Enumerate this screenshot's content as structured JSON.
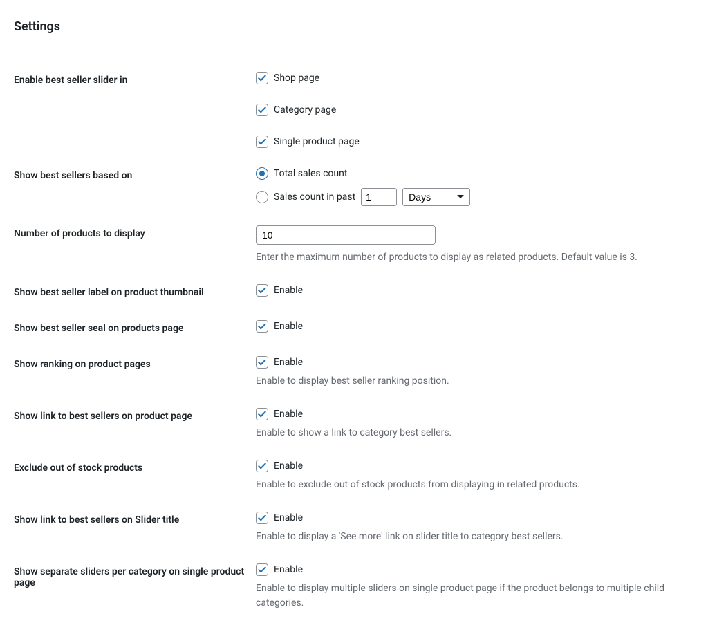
{
  "page": {
    "title": "Settings"
  },
  "rows": {
    "enable_slider": {
      "label": "Enable best seller slider in",
      "options": [
        "Shop page",
        "Category page",
        "Single product page"
      ]
    },
    "based_on": {
      "label": "Show best sellers based on",
      "radio_total": "Total sales count",
      "radio_past": "Sales count in past",
      "past_value": "1",
      "unit_selected": "Days"
    },
    "num_products": {
      "label": "Number of products to display",
      "value": "10",
      "desc": "Enter the maximum number of products to display as related products. Default value is 3."
    },
    "label_thumb": {
      "label": "Show best seller label on product thumbnail",
      "enable": "Enable"
    },
    "seal_page": {
      "label": "Show best seller seal on products page",
      "enable": "Enable"
    },
    "ranking": {
      "label": "Show ranking on product pages",
      "enable": "Enable",
      "desc": "Enable to display best seller ranking position."
    },
    "link_product": {
      "label": "Show link to best sellers on product page",
      "enable": "Enable",
      "desc": "Enable to show a link to category best sellers."
    },
    "exclude_oos": {
      "label": "Exclude out of stock products",
      "enable": "Enable",
      "desc": "Enable to exclude out of stock products from displaying in related products."
    },
    "link_slider": {
      "label": "Show link to best sellers on Slider title",
      "enable": "Enable",
      "desc": "Enable to display a 'See more' link on slider title to category best sellers."
    },
    "separate_sliders": {
      "label": "Show separate sliders per category on single product page",
      "enable": "Enable",
      "desc": "Enable to display multiple sliders on single product page if the product belongs to multiple child categories."
    }
  }
}
